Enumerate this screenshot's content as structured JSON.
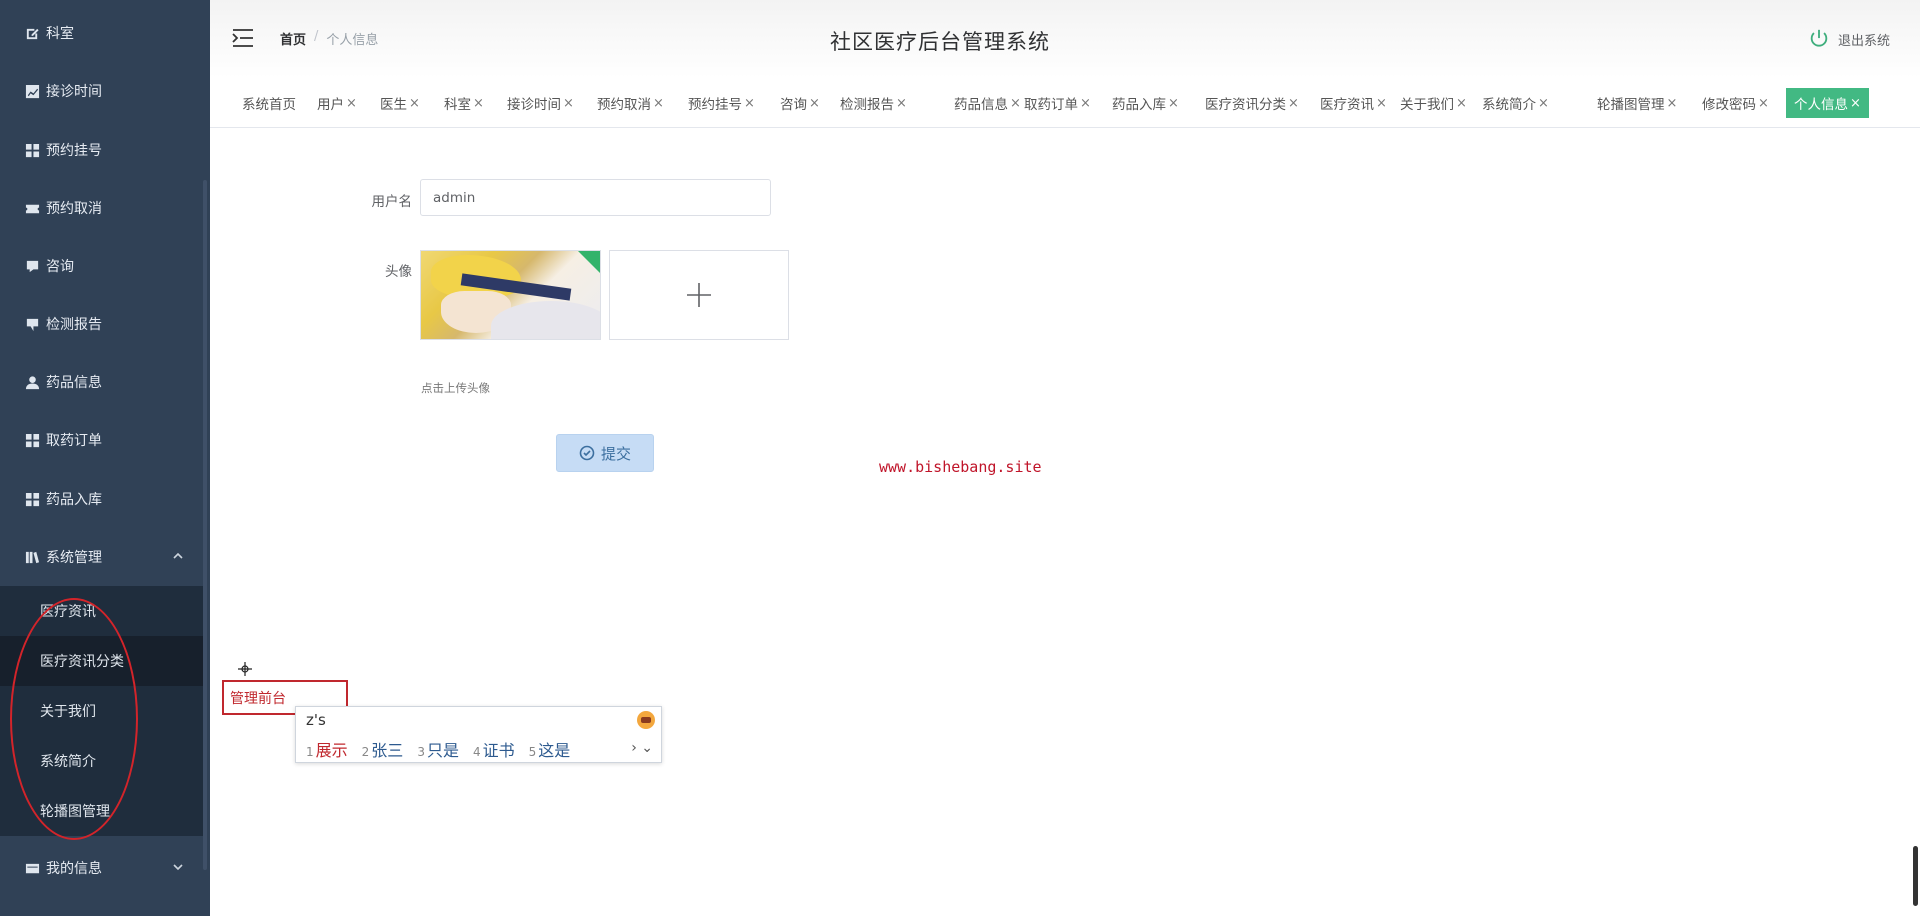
{
  "sidebar": {
    "items": [
      {
        "label": "科室",
        "icon": "edit-icon"
      },
      {
        "label": "接诊时间",
        "icon": "chart-icon"
      },
      {
        "label": "预约挂号",
        "icon": "grid-icon"
      },
      {
        "label": "预约取消",
        "icon": "ticket-icon"
      },
      {
        "label": "咨询",
        "icon": "chat-icon"
      },
      {
        "label": "检测报告",
        "icon": "comment-icon"
      },
      {
        "label": "药品信息",
        "icon": "user-icon"
      },
      {
        "label": "取药订单",
        "icon": "grid-icon"
      },
      {
        "label": "药品入库",
        "icon": "grid-icon"
      },
      {
        "label": "系统管理",
        "icon": "library-icon"
      }
    ],
    "submenu": [
      "医疗资讯",
      "医疗资讯分类",
      "关于我们",
      "系统简介",
      "轮播图管理"
    ],
    "my_info": "我的信息"
  },
  "header": {
    "breadcrumb_home": "首页",
    "breadcrumb_sep": "/",
    "breadcrumb_current": "个人信息",
    "title": "社区医疗后台管理系统",
    "logout": "退出系统"
  },
  "tags": [
    "系统首页",
    "用户",
    "医生",
    "科室",
    "接诊时间",
    "预约取消",
    "预约挂号",
    "咨询",
    "检测报告",
    "药品信息",
    "取药订单",
    "药品入库",
    "医疗资讯分类",
    "医疗资讯",
    "关于我们",
    "系统简介",
    "轮播图管理",
    "修改密码",
    "个人信息"
  ],
  "close_glyph": "×",
  "form": {
    "username_label": "用户名",
    "username_value": "admin",
    "avatar_label": "头像",
    "upload_tip": "点击上传头像",
    "submit_label": "提交"
  },
  "watermark": "www.bishebang.site",
  "typing": {
    "text": "管理前台",
    "ime_input": "z's",
    "candidates": [
      {
        "n": "1",
        "t": "展示"
      },
      {
        "n": "2",
        "t": "张三"
      },
      {
        "n": "3",
        "t": "只是"
      },
      {
        "n": "4",
        "t": "证书"
      },
      {
        "n": "5",
        "t": "这是"
      }
    ],
    "nav": "› ⌄"
  },
  "colors": {
    "sidebar_bg": "#304156",
    "accent": "#42b983",
    "mark_red": "#d3242a"
  }
}
